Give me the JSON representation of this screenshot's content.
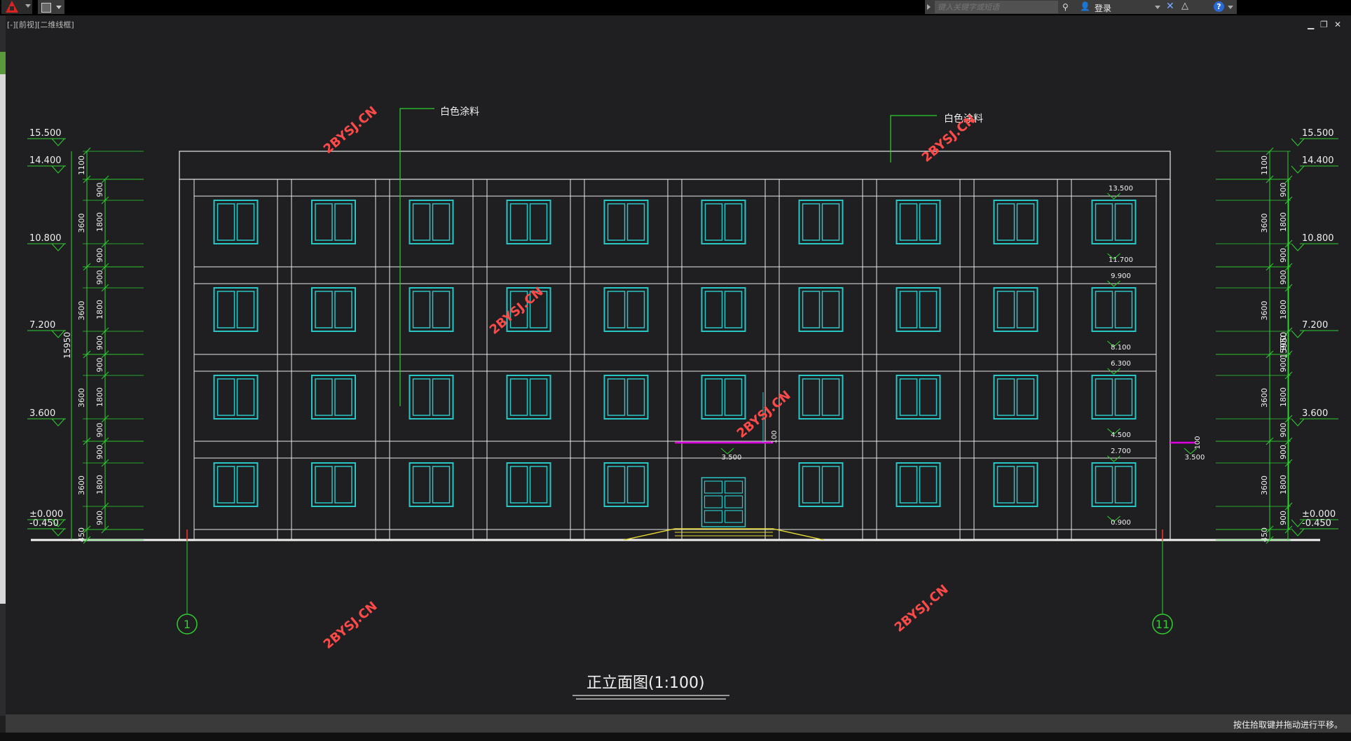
{
  "toolbar": {
    "app_icon": "autocad-logo-icon",
    "search_placeholder": "键入关键字或短语",
    "login_label": "登录"
  },
  "viewport": {
    "view_label": "[-][前视][二维线框]",
    "status_text": "按住拾取键并拖动进行平移。"
  },
  "drawing": {
    "title": "正立面图(1:100)",
    "material_note_1": "白色涂料",
    "material_note_2": "白色涂料",
    "axis_left": "1",
    "axis_right": "11",
    "watermark": "2BYSJ.CN",
    "left_elevations": [
      "15.500",
      "14.400",
      "10.800",
      "7.200",
      "3.600",
      "±0.000",
      "-0.450"
    ],
    "right_elevations": [
      "15.500",
      "14.400",
      "10.800",
      "7.200",
      "3.600",
      "±0.000",
      "-0.450"
    ],
    "total_height": "15950",
    "floor_dims": [
      "1100",
      "3600",
      "3600",
      "3600",
      "3600",
      "450"
    ],
    "window_dims": [
      "900",
      "1800",
      "900",
      "900",
      "1800",
      "900",
      "900",
      "1800",
      "900",
      "900",
      "1800",
      "900"
    ],
    "window_levels": [
      "13.500",
      "11.700",
      "9.900",
      "8.100",
      "6.300",
      "4.500",
      "2.700",
      "0.900"
    ],
    "canopy_level": "3.500",
    "canopy_dim": "100"
  }
}
